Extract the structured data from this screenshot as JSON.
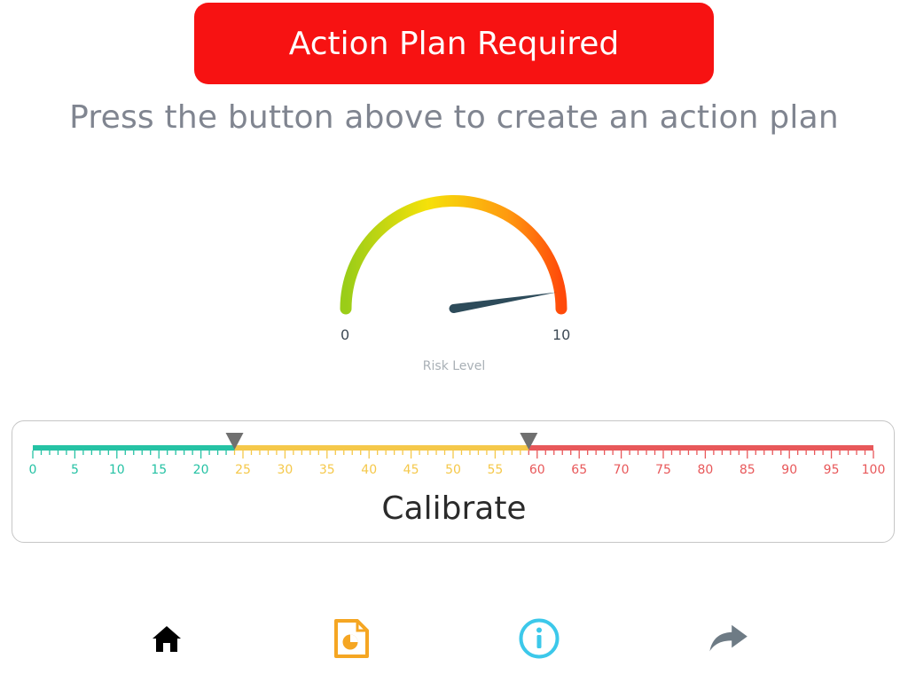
{
  "action_button": {
    "label": "Action Plan Required",
    "color": "#f71212"
  },
  "instruction": {
    "text": "Press the button above to create an action plan"
  },
  "gauge": {
    "min_label": "0",
    "max_label": "10",
    "caption": "Risk Level",
    "value": 9.5,
    "min": 0,
    "max": 10,
    "needle_color": "#2d4b5a",
    "gradient_colors": [
      "#9acd18",
      "#f5e10a",
      "#ff9a10",
      "#ff4a0a"
    ]
  },
  "calibrate": {
    "label": "Calibrate",
    "min": 0,
    "max": 100,
    "tick_labels": [
      "0",
      "5",
      "10",
      "15",
      "20",
      "25",
      "30",
      "35",
      "40",
      "45",
      "50",
      "55",
      "60",
      "65",
      "70",
      "75",
      "80",
      "85",
      "90",
      "95",
      "100"
    ],
    "threshold_low": 24,
    "threshold_high": 59,
    "colors": {
      "low": "#25c2a4",
      "mid": "#f5c84a",
      "high": "#e8585a",
      "marker": "#707070"
    }
  },
  "nav": [
    {
      "icon": "home-icon",
      "color": "#000000"
    },
    {
      "icon": "report-icon",
      "color": "#f5a623"
    },
    {
      "icon": "info-icon",
      "color": "#3cc8ea"
    },
    {
      "icon": "share-icon",
      "color": "#6e7b85"
    }
  ]
}
